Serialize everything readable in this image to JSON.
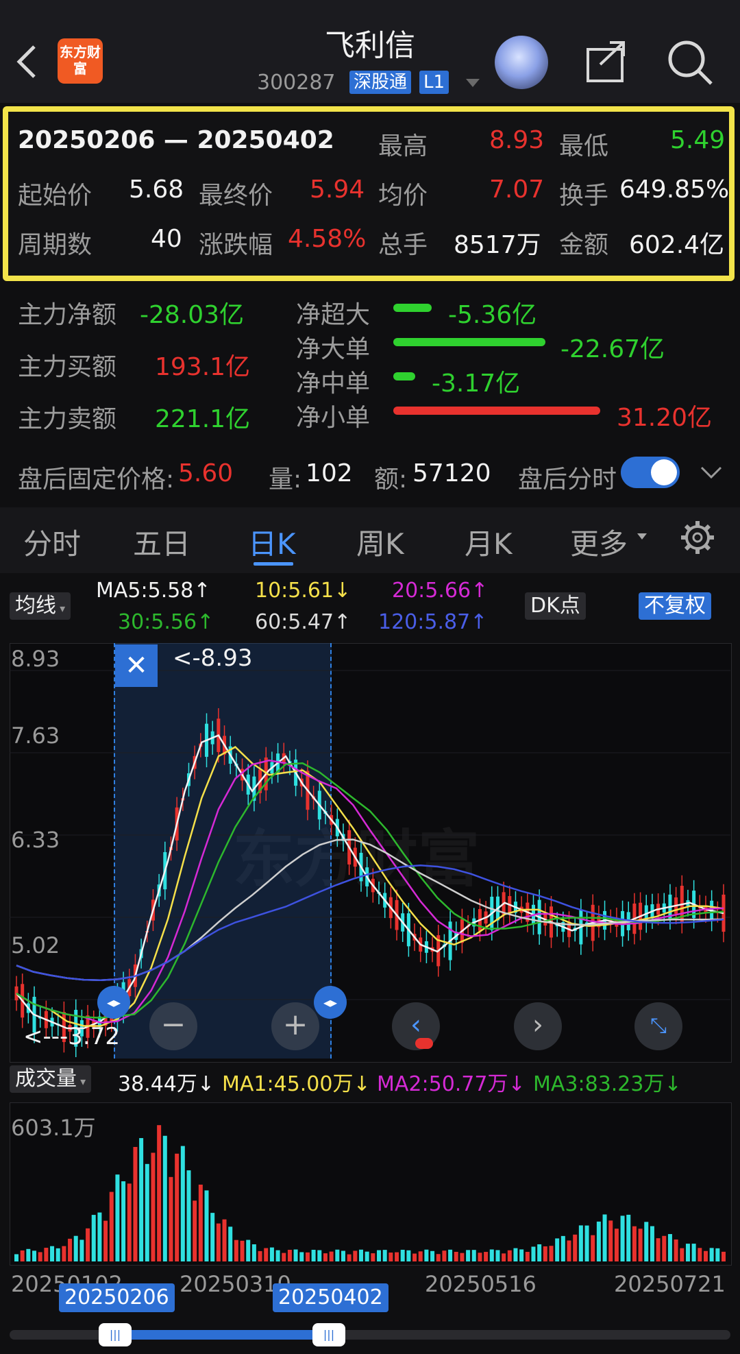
{
  "header": {
    "back_icon": "chevron-left-icon",
    "logo_text": "东方财富",
    "title": "飞利信",
    "code": "300287",
    "tag1": "深股通",
    "tag2": "L1"
  },
  "summary": {
    "range": "20250206 — 20250402",
    "high_label": "最高",
    "high": "8.93",
    "low_label": "最低",
    "low": "5.49",
    "start_label": "起始价",
    "start": "5.68",
    "end_label": "最终价",
    "end": "5.94",
    "avg_label": "均价",
    "avg": "7.07",
    "turnover_label": "换手",
    "turnover": "649.85%",
    "periods_label": "周期数",
    "periods": "40",
    "change_label": "涨跌幅",
    "change": "4.58%",
    "vol_label": "总手",
    "vol": "8517万",
    "amount_label": "金额",
    "amount": "602.4亿"
  },
  "capital": {
    "net_label": "主力净额",
    "net": "-28.03亿",
    "buy_label": "主力买额",
    "buy": "193.1亿",
    "sell_label": "主力卖额",
    "sell": "221.1亿",
    "rows": [
      {
        "label": "净超大",
        "value": "-5.36亿"
      },
      {
        "label": "净大单",
        "value": "-22.67亿"
      },
      {
        "label": "净中单",
        "value": "-3.17亿"
      },
      {
        "label": "净小单",
        "value": "31.20亿"
      }
    ]
  },
  "after_hours": {
    "price_label": "盘后固定价格:",
    "price": "5.60",
    "vol_label": "量:",
    "vol": "102",
    "amt_label": "额:",
    "amt": "57120",
    "toggle_label": "盘后分时",
    "toggle_on": true
  },
  "tabs": [
    "分时",
    "五日",
    "日K",
    "周K",
    "月K",
    "更多"
  ],
  "active_tab": "日K",
  "ma": {
    "selector": "均线",
    "ma5": "MA5:5.58↑",
    "ma10": "10:5.61↓",
    "ma20": "20:5.66↑",
    "ma30": "30:5.56↑",
    "ma60": "60:5.47↑",
    "ma120": "120:5.87↑",
    "dk": "DK点",
    "fq": "不复权"
  },
  "chart": {
    "y_labels": [
      "8.93",
      "7.63",
      "6.33",
      "5.02",
      "3.72"
    ],
    "high_marker": "<-8.93",
    "low_marker": "<---3.72",
    "watermark": "东方财富"
  },
  "volume": {
    "selector": "成交量",
    "cur": "38.44万↓",
    "ma1": "MA1:45.00万↓",
    "ma2": "MA2:50.77万↓",
    "ma3": "MA3:83.23万↓",
    "max": "603.1万"
  },
  "x_labels": [
    "20250102",
    "20250310",
    "20250516",
    "20250721"
  ],
  "range_badges": [
    "20250206",
    "20250402"
  ],
  "colors": {
    "up": "#e8322e",
    "down": "#2fd12f",
    "accent": "#2d6fd4",
    "highlight": "#f2e34a"
  }
}
